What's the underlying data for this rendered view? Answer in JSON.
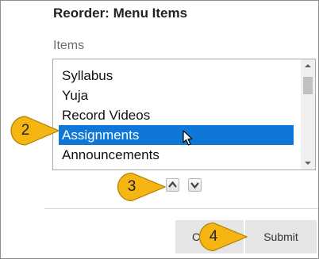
{
  "dialog": {
    "title": "Reorder: Menu Items",
    "items_label": "Items",
    "list_items": [
      {
        "label": "Syllabus",
        "selected": false
      },
      {
        "label": "Yuja",
        "selected": false
      },
      {
        "label": "Record Videos",
        "selected": false
      },
      {
        "label": "Assignments",
        "selected": true
      },
      {
        "label": "Announcements",
        "selected": false
      }
    ],
    "cancel_label": "C",
    "submit_label": "Submit"
  },
  "callouts": [
    "2",
    "3",
    "4"
  ],
  "colors": {
    "selection": "#0f78d7",
    "callout_fill": "#f5b513",
    "callout_stroke": "#b37e00",
    "button_bg": "#e5e5e5"
  },
  "icons": {
    "move_up": "chevron-up-icon",
    "move_down": "chevron-down-icon",
    "pointer": "mouse-pointer-icon"
  }
}
